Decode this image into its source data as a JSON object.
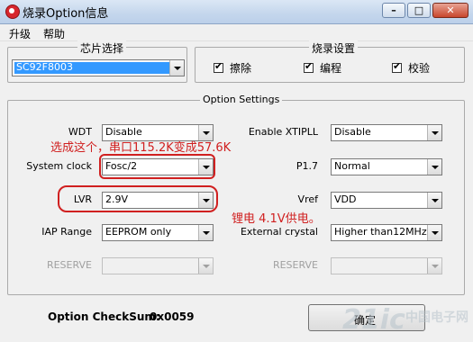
{
  "window": {
    "title": "烧录Option信息",
    "min_glyph": "–",
    "max_glyph": "□",
    "close_glyph": "✕"
  },
  "menu": {
    "items": [
      "升级",
      "帮助"
    ]
  },
  "chip_select": {
    "title": "芯片选择",
    "value": "SC92F8003"
  },
  "burn_settings": {
    "title": "烧录设置",
    "items": [
      {
        "label": "擦除",
        "checked": true
      },
      {
        "label": "编程",
        "checked": true
      },
      {
        "label": "校验",
        "checked": true
      }
    ]
  },
  "option_settings": {
    "title": "Option Settings",
    "left": [
      {
        "label": "WDT",
        "value": "Disable",
        "enabled": true
      },
      {
        "label": "System clock",
        "value": "Fosc/2",
        "enabled": true
      },
      {
        "label": "LVR",
        "value": "2.9V",
        "enabled": true
      },
      {
        "label": "IAP Range",
        "value": "EEPROM only",
        "enabled": true
      },
      {
        "label": "RESERVE",
        "value": "",
        "enabled": false
      }
    ],
    "right": [
      {
        "label": "Enable XTIPLL",
        "value": "Disable",
        "enabled": true
      },
      {
        "label": "P1.7",
        "value": "Normal",
        "enabled": true
      },
      {
        "label": "Vref",
        "value": "VDD",
        "enabled": true
      },
      {
        "label": "External crystal",
        "value": "Higher than12MHz",
        "enabled": true
      },
      {
        "label": "RESERVE",
        "value": "",
        "enabled": false
      }
    ]
  },
  "annotations": {
    "note1": "选成这个，串口115.2K变成57.6K",
    "note2": "锂电 4.1V供电。",
    "color": "#d02020"
  },
  "checksum": {
    "label": "Option CheckSum:",
    "value": "0x0059"
  },
  "ok_button": {
    "label": "确定"
  },
  "watermark": {
    "text": "21ic 中国电子网"
  }
}
